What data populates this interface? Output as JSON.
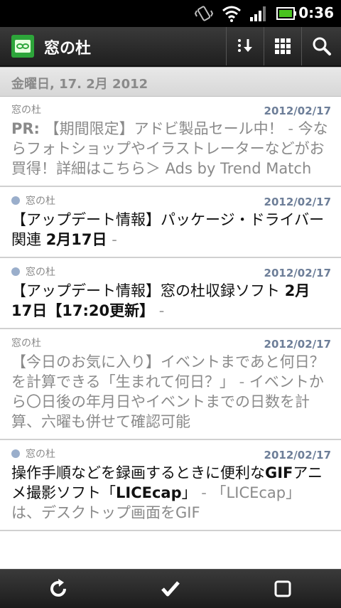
{
  "status": {
    "time": "0:36"
  },
  "app": {
    "title": "窓の杜"
  },
  "date_header": "金曜日, 17. 2月 2012",
  "items": [
    {
      "source": "窓の杜",
      "date": "2012/02/17",
      "prefix": "PR:",
      "title": "【期間限定】アドビ製品セール中！",
      "sep": " - ",
      "summary": "今ならフォトショップやイラストレーターなどがお買得！詳細はこちら＞ Ads by Trend Match"
    },
    {
      "source": "窓の杜",
      "date": "2012/02/17",
      "title_a": "【アップデート情報】パッケージ・ドライバー関連 ",
      "title_b": "2月17日",
      "sep": " -"
    },
    {
      "source": "窓の杜",
      "date": "2012/02/17",
      "title_a": "【アップデート情報】窓の杜収録ソフト ",
      "title_b": "2月17日【17:20更新】",
      "sep": " -"
    },
    {
      "source": "窓の杜",
      "date": "2012/02/17",
      "title": "【今日のお気に入り】イベントまであと何日？を計算できる「生まれて何日？」",
      "sep": " - ",
      "summary": "イベントから〇日後の年月日やイベントまでの日数を計算、六曜も併せて確認可能"
    },
    {
      "source": "窓の杜",
      "date": "2012/02/17",
      "title_a": "操作手順などを録画するときに便利な",
      "title_b": "GIF",
      "title_c": "アニメ撮影ソフト「",
      "title_d": "LICEcap",
      "title_e": "」",
      "sep": " - ",
      "summary": "「LICEcap」は、デスクトップ画面をGIF"
    }
  ]
}
